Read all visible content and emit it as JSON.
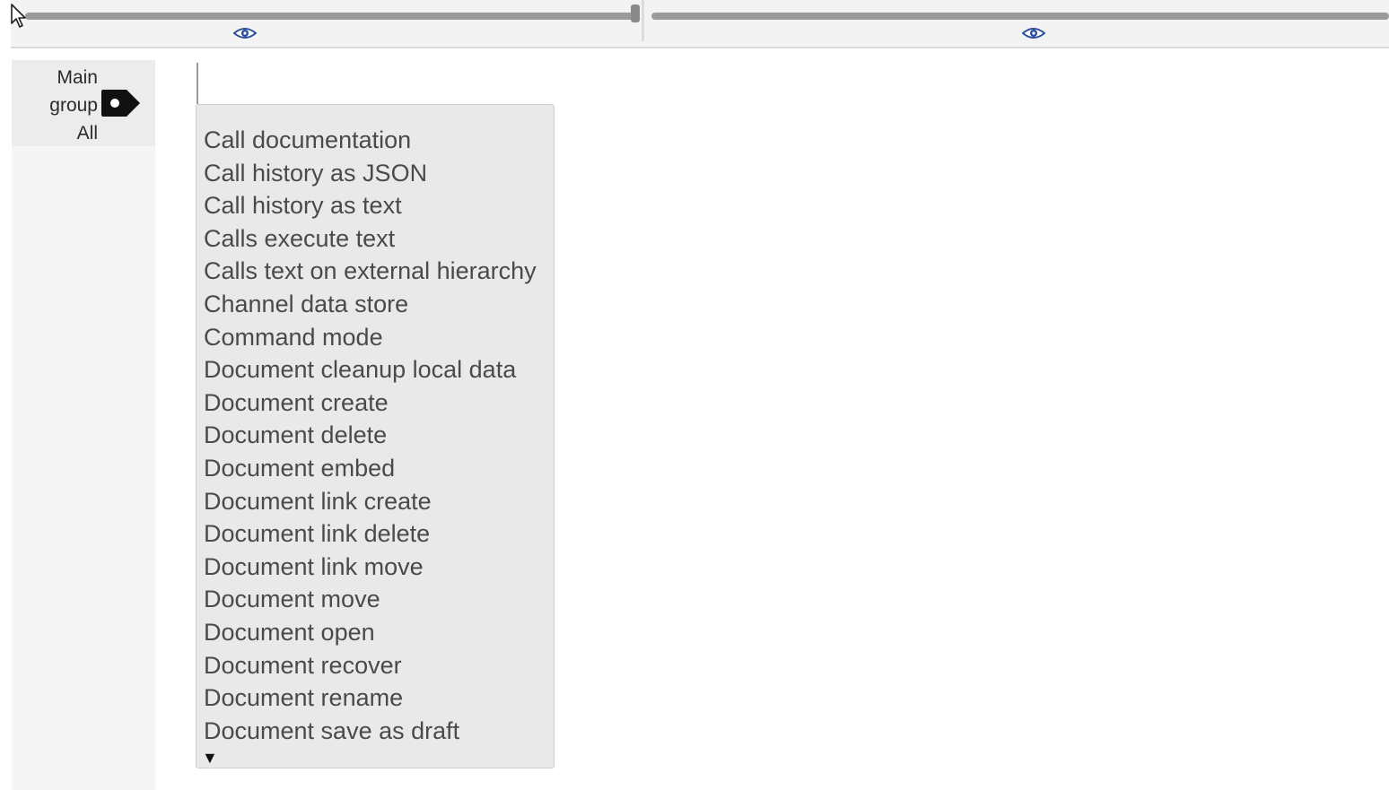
{
  "sidebar": {
    "group_lines": [
      "Main",
      "group",
      "All"
    ],
    "tag_icon": "tag-icon"
  },
  "top_bar": {
    "left_pane_icon": "eye-icon",
    "right_pane_icon": "eye-icon",
    "accent_color": "#2b4f9a"
  },
  "dropdown": {
    "items": [
      "Call documentation",
      "Call history as JSON",
      "Call history as text",
      "Calls execute text",
      "Calls text on external hierarchy",
      "Channel data store",
      "Command mode",
      "Document cleanup local data",
      "Document create",
      "Document delete",
      "Document embed",
      "Document link create",
      "Document link delete",
      "Document link move",
      "Document move",
      "Document open",
      "Document recover",
      "Document rename",
      "Document save as draft"
    ],
    "more_indicator": "▼"
  }
}
